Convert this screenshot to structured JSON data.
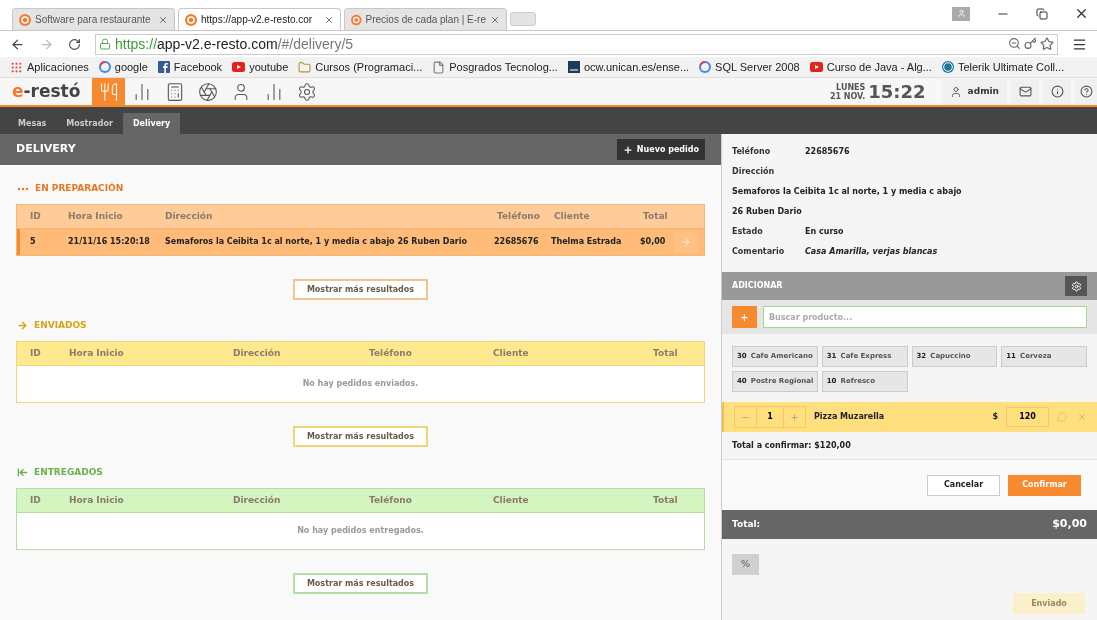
{
  "browser": {
    "tabs": [
      {
        "title": "Software para restaurante",
        "selected": false
      },
      {
        "title": "https://app-v2.e-resto.cor",
        "selected": true
      },
      {
        "title": "Precios de cada plan | E-re",
        "selected": false
      }
    ],
    "url": {
      "scheme": "https://",
      "host": "app-v2.e-resto.com",
      "path": "/#/delivery/5"
    },
    "bookmarks": [
      {
        "kind": "apps",
        "label": "Aplicaciones"
      },
      {
        "kind": "google",
        "label": "google"
      },
      {
        "kind": "facebook",
        "label": "Facebook"
      },
      {
        "kind": "youtube",
        "label": "youtube"
      },
      {
        "kind": "folder",
        "label": "Cursos (Programaci..."
      },
      {
        "kind": "page",
        "label": "Posgrados Tecnolog..."
      },
      {
        "kind": "uc",
        "label": "ocw.unican.es/ense..."
      },
      {
        "kind": "google",
        "label": "SQL Server 2008"
      },
      {
        "kind": "youtube",
        "label": "Curso de Java - Alg..."
      },
      {
        "kind": "wordpress",
        "label": "Telerik Ultimate Coll..."
      }
    ]
  },
  "app": {
    "logo": {
      "mark": "e",
      "name": "-restó"
    },
    "nav": [
      {
        "kind": "utensils",
        "selected": true
      },
      {
        "kind": "bars",
        "selected": false
      },
      {
        "kind": "calculator",
        "selected": false
      },
      {
        "kind": "aperture",
        "selected": false
      },
      {
        "kind": "user",
        "selected": false
      },
      {
        "kind": "chart",
        "selected": false
      },
      {
        "kind": "settings",
        "selected": false
      }
    ],
    "day": "LUNES",
    "date": "21 NOV.",
    "time": "15:22",
    "user": "admin",
    "subtabs": [
      {
        "label": "Mesas",
        "selected": false
      },
      {
        "label": "Mostrador",
        "selected": false
      },
      {
        "label": "Delivery",
        "selected": true
      }
    ]
  },
  "delivery": {
    "title": "DELIVERY",
    "new_button": "Nuevo pedido",
    "sections": [
      {
        "kind": "preparing",
        "title": "EN PREPARACIÓN",
        "columns": [
          "ID",
          "Hora Inicio",
          "Dirección",
          "Teléfono",
          "Cliente",
          "Total"
        ],
        "rows": [
          {
            "selected": true,
            "cells": [
              "5",
              "21/11/16 15:20:18",
              "Semaforos la Ceibita 1c al norte, 1 y media c abajo 26 Ruben Dario",
              "22685676",
              "Thelma Estrada",
              "$0,00"
            ]
          }
        ],
        "more_button": "Mostrar más resultados"
      },
      {
        "kind": "sent",
        "title": "ENVIADOS",
        "columns": [
          "ID",
          "Hora Inicio",
          "Dirección",
          "Teléfono",
          "Cliente",
          "Total"
        ],
        "empty": "No hay pedidos enviados.",
        "more_button": "Mostrar más resultados"
      },
      {
        "kind": "delivered",
        "title": "ENTREGADOS",
        "columns": [
          "ID",
          "Hora Inicio",
          "Dirección",
          "Teléfono",
          "Cliente",
          "Total"
        ],
        "empty": "No hay pedidos entregados.",
        "more_button": "Mostrar más resultados"
      }
    ]
  },
  "detail": {
    "fields": [
      {
        "kind": "pair",
        "label": "Teléfono",
        "value": "22685676"
      },
      {
        "kind": "label",
        "label": "Dirección"
      },
      {
        "kind": "line",
        "value": "Semaforos la Ceibita 1c al norte, 1 y media c abajo"
      },
      {
        "kind": "line",
        "value": "26 Ruben Dario"
      },
      {
        "kind": "pair",
        "label": "Estado",
        "value": "En curso"
      },
      {
        "kind": "note",
        "label": "Comentario",
        "value": "Casa Amarilla, verjas blancas"
      }
    ],
    "add": {
      "title": "ADICIONAR",
      "plus": "+",
      "placeholder": "Buscar producto...",
      "products": [
        {
          "code": "30",
          "name": "Cafe Americano"
        },
        {
          "code": "31",
          "name": "Cafe Express"
        },
        {
          "code": "32",
          "name": "Capuccino"
        },
        {
          "code": "11",
          "name": "Cerveza"
        },
        {
          "code": "40",
          "name": "Postre Regional"
        },
        {
          "code": "10",
          "name": "Refresco"
        }
      ],
      "items": [
        {
          "qty": "1",
          "name": "Pizza Muzarella",
          "currency": "$",
          "price": "120"
        }
      ],
      "to_confirm": "Total a confirmar: $120,00",
      "cancel": "Cancelar",
      "confirm": "Confirmar"
    },
    "total_label": "Total:",
    "total": "$0,00",
    "discount": {
      "label": "%",
      "disabled": true
    },
    "sent": {
      "label": "Enviado",
      "disabled": true
    }
  }
}
